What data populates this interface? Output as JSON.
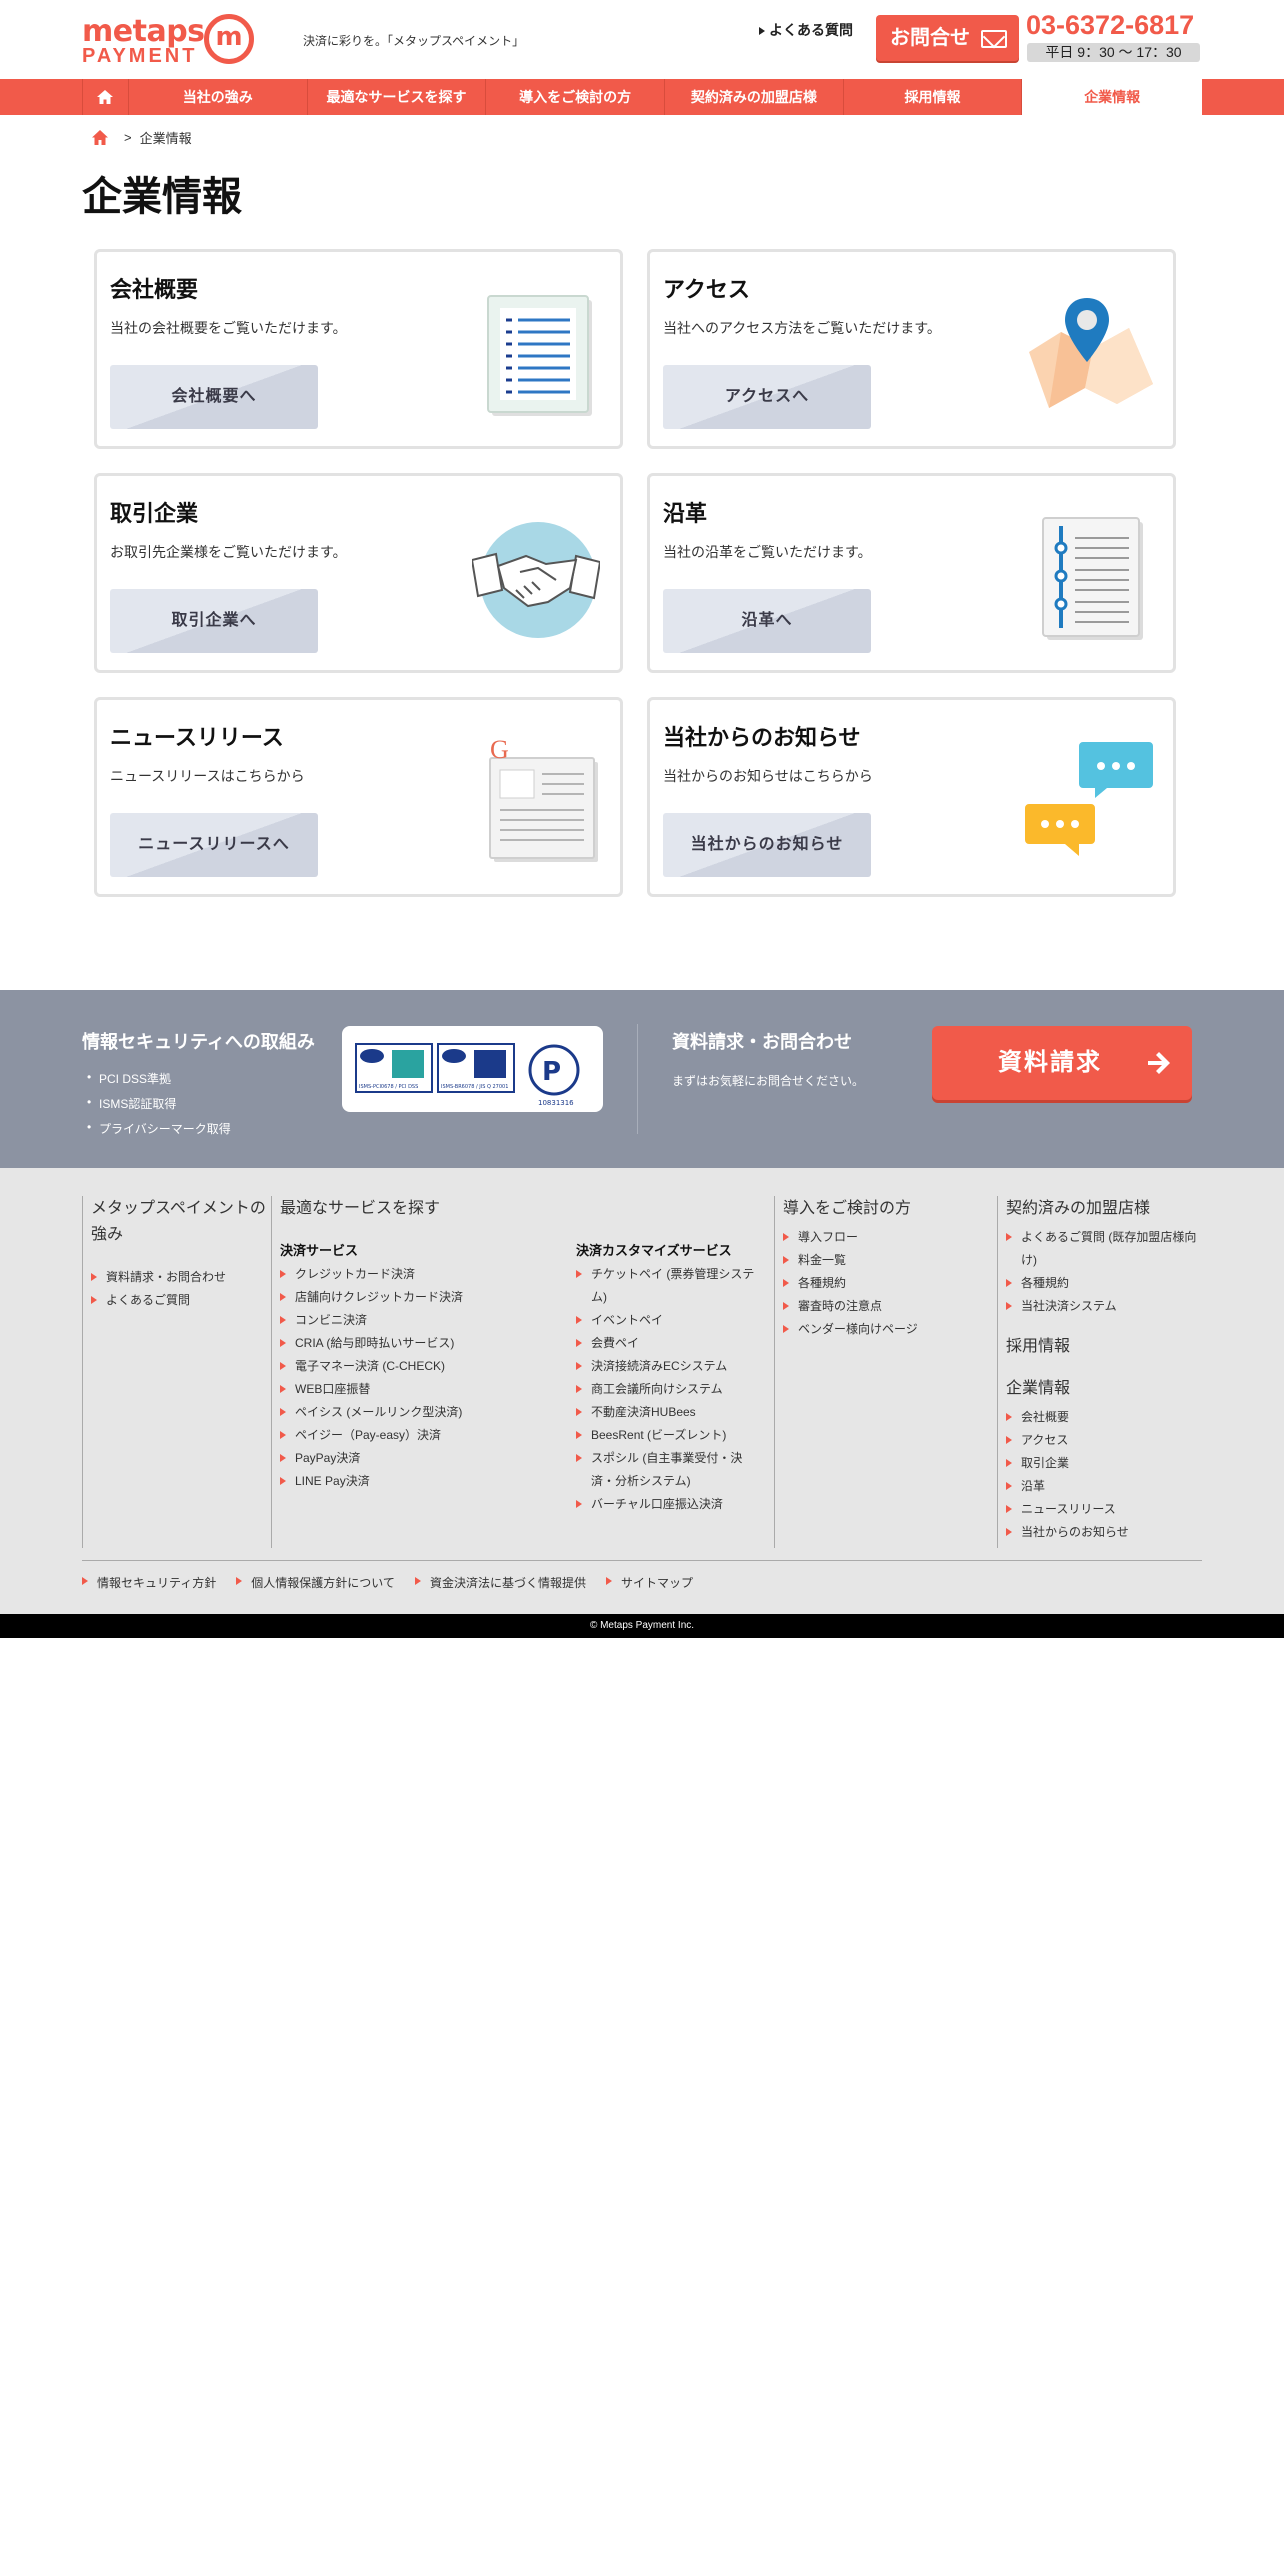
{
  "header": {
    "logo_top": "metaps",
    "logo_bottom": "PAYMENT",
    "logo_mark": "m",
    "tagline": "決済に彩りを。「メタップスペイメント」",
    "faq": "よくある質問",
    "contact": "お問合せ",
    "phone": "03-6372-6817",
    "hours": "平日 9：30 〜 17：30"
  },
  "nav": {
    "items": [
      "当社の強み",
      "最適なサービスを探す",
      "導入をご検討の方",
      "契約済みの加盟店様",
      "採用情報",
      "企業情報"
    ]
  },
  "breadcrumb": {
    "current": "企業情報",
    "sep": ">"
  },
  "page_title": "企業情報",
  "cards": [
    {
      "title": "会社概要",
      "desc": "当社の会社概要をご覧いただけます。",
      "button": "会社概要へ",
      "icon": "document-icon"
    },
    {
      "title": "アクセス",
      "desc": "当社へのアクセス方法をご覧いただけます。",
      "button": "アクセスへ",
      "icon": "map-pin-icon"
    },
    {
      "title": "取引企業",
      "desc": "お取引先企業様をご覧いただけます。",
      "button": "取引企業へ",
      "icon": "handshake-icon"
    },
    {
      "title": "沿革",
      "desc": "当社の沿革をご覧いただけます。",
      "button": "沿革へ",
      "icon": "timeline-icon"
    },
    {
      "title": "ニュースリリース",
      "desc": "ニュースリリースはこちらから",
      "button": "ニュースリリースへ",
      "icon": "newspaper-icon"
    },
    {
      "title": "当社からのお知らせ",
      "desc": "当社からのお知らせはこちらから",
      "button": "当社からのお知らせ",
      "icon": "chat-bubbles-icon"
    }
  ],
  "security": {
    "title": "情報セキュリティへの取組み",
    "items": [
      "PCI DSS準拠",
      "ISMS認証取得",
      "プライバシーマーク取得"
    ],
    "cert_labels": [
      "ISMS-PCI0678 / PCI DSS",
      "ISMS-BR6078 / JIS Q 27001",
      "10831316"
    ]
  },
  "request": {
    "title": "資料請求・お問合わせ",
    "sub": "まずはお気軽にお問合せください。",
    "button": "資料請求"
  },
  "footer": {
    "col1": {
      "head": "メタップスペイメントの強み",
      "items": [
        "資料請求・お問合わせ",
        "よくあるご質問"
      ]
    },
    "col2": {
      "head": "最適なサービスを探す",
      "sub1": "決済サービス",
      "items1": [
        "クレジットカード決済",
        "店舗向けクレジットカード決済",
        "コンビニ決済",
        "CRIA (給与即時払いサービス)",
        "電子マネー決済 (C-CHECK)",
        "WEB口座振替",
        "ペイシス (メールリンク型決済)",
        "ペイジー（Pay-easy）決済",
        "PayPay決済",
        "LINE Pay決済"
      ],
      "sub2": "決済カスタマイズサービス",
      "items2": [
        "チケットペイ (票券管理システム)",
        "イベントペイ",
        "会費ペイ",
        "決済接続済みECシステム",
        "商工会議所向けシステム",
        "不動産決済HUBees",
        "BeesRent (ビーズレント)",
        "スポシル (自主事業受付・決済・分析システム)",
        "バーチャル口座振込決済"
      ]
    },
    "col3": {
      "head": "導入をご検討の方",
      "items": [
        "導入フロー",
        "料金一覧",
        "各種規約",
        "審査時の注意点",
        "ベンダー様向けページ"
      ]
    },
    "col4": {
      "head": "契約済みの加盟店様",
      "items": [
        "よくあるご質問 (既存加盟店様向け)",
        "各種規約",
        "当社決済システム"
      ],
      "head2": "採用情報",
      "head3": "企業情報",
      "items3": [
        "会社概要",
        "アクセス",
        "取引企業",
        "沿革",
        "ニュースリリース",
        "当社からのお知らせ"
      ]
    },
    "bottom": [
      "情報セキュリティ方針",
      "個人情報保護方針について",
      "資金決済法に基づく情報提供",
      "サイトマップ"
    ]
  },
  "copyright": "© Metaps Payment Inc.",
  "colors": {
    "accent": "#f15a4a",
    "band": "#8c93a2",
    "footer_bg": "#e6e6e6"
  }
}
